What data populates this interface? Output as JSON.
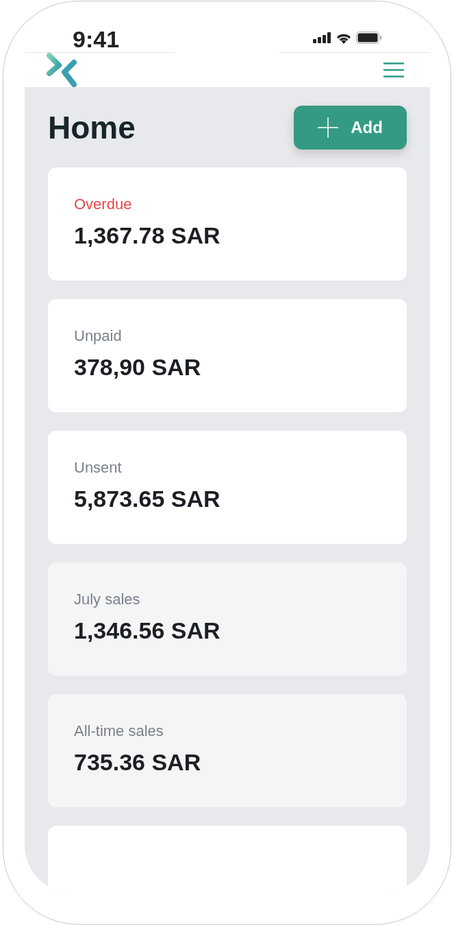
{
  "status_bar": {
    "time": "9:41"
  },
  "page": {
    "title": "Home",
    "add_button": "Add"
  },
  "cards": [
    {
      "kind": "alert",
      "label": "Overdue",
      "amount": "1,367.78 SAR"
    },
    {
      "kind": "open",
      "label": "Unpaid",
      "amount": "378,90 SAR"
    },
    {
      "kind": "open",
      "label": "Unsent",
      "amount": "5,873.65 SAR"
    },
    {
      "kind": "summary",
      "label": "July sales",
      "amount": "1,346.56 SAR"
    },
    {
      "kind": "summary",
      "label": "All-time sales",
      "amount": "735.36 SAR"
    },
    {
      "kind": "open"
    }
  ]
}
